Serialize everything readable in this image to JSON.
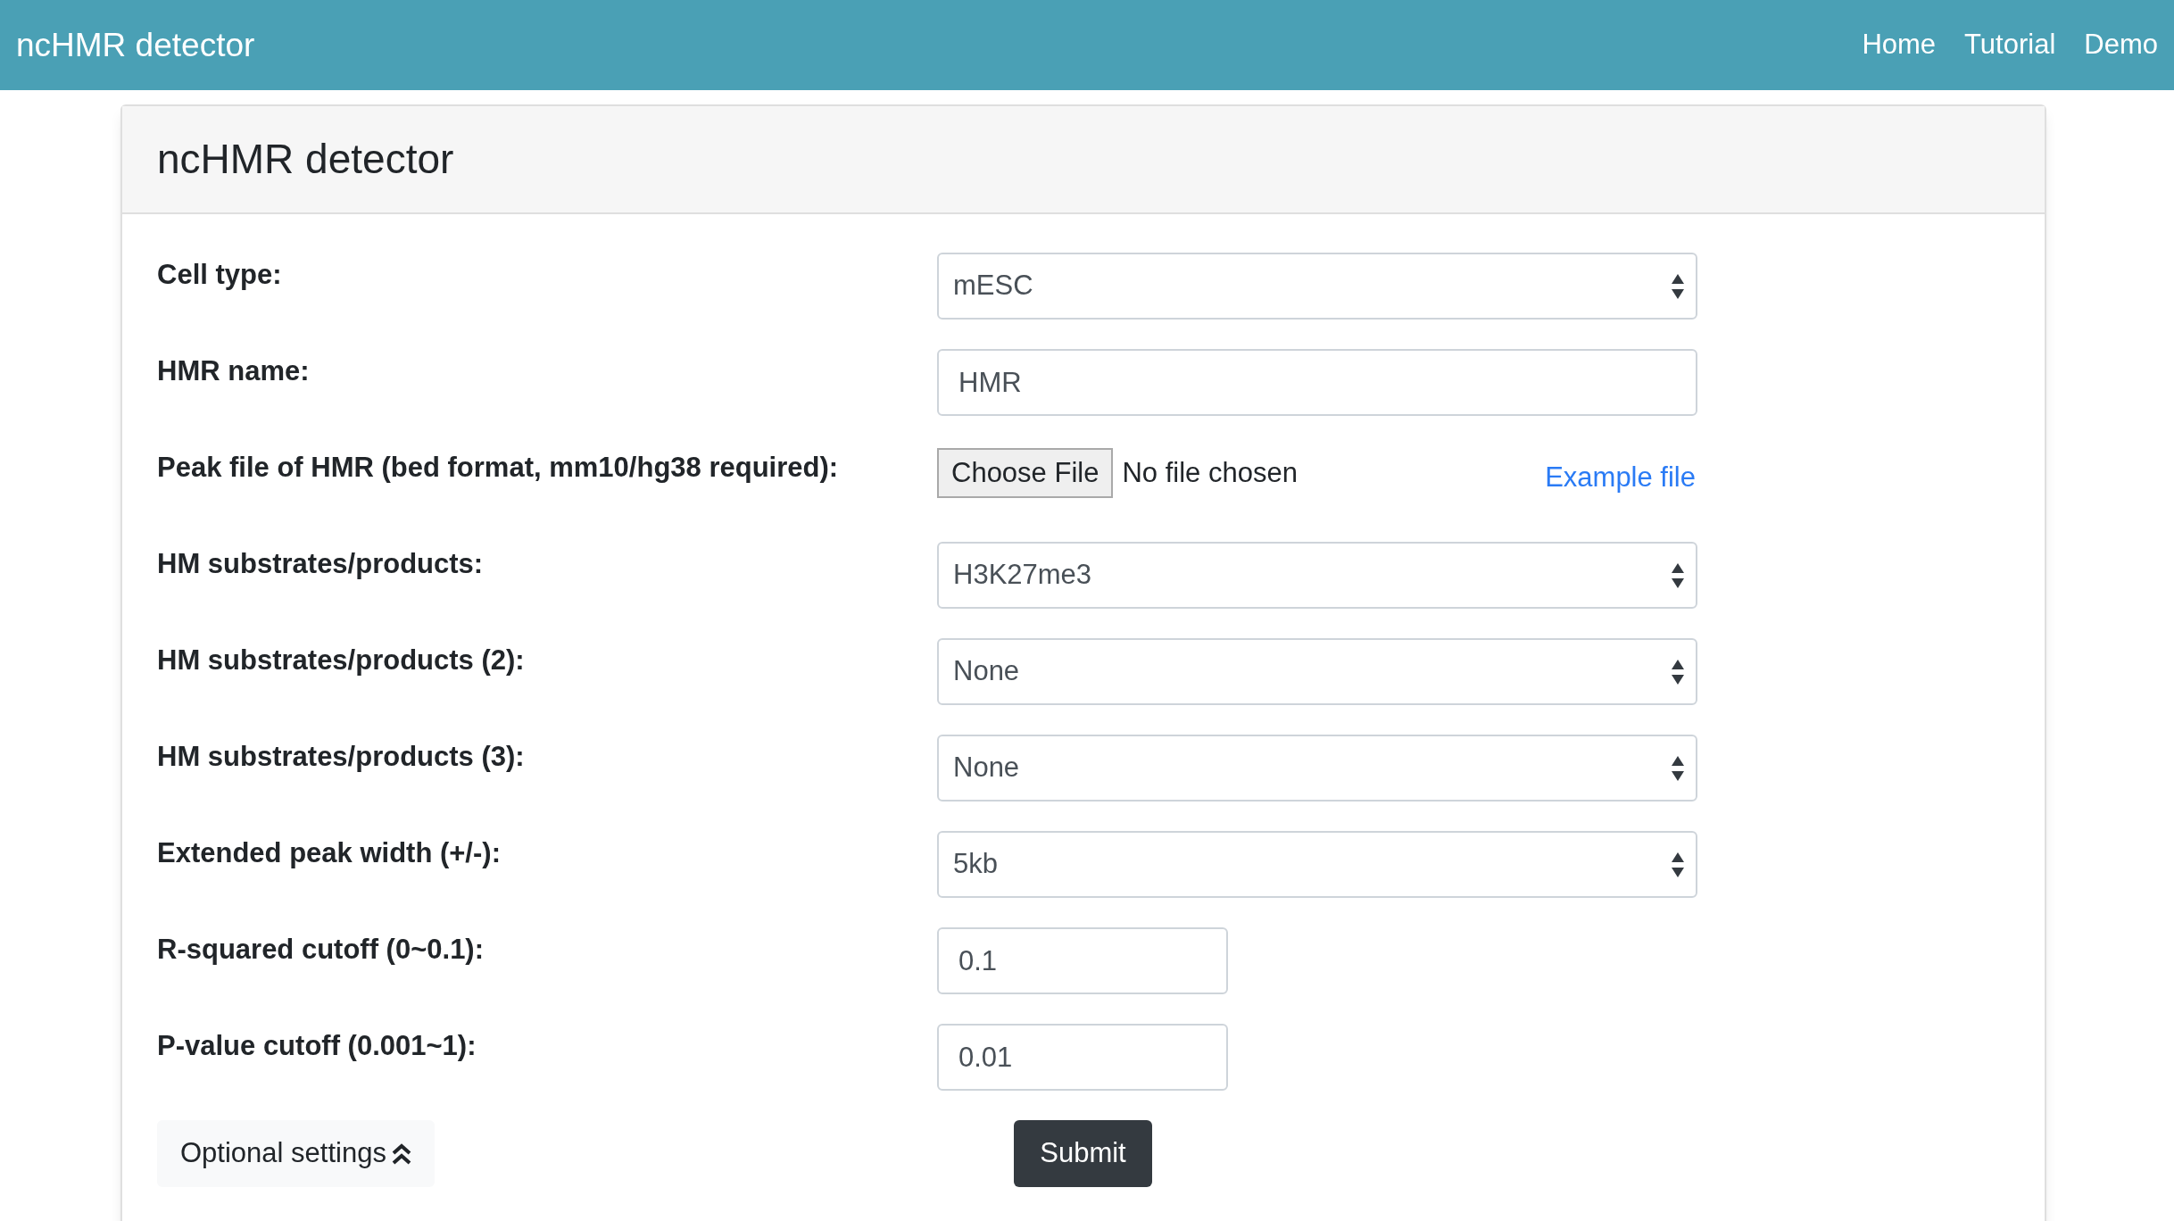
{
  "navbar": {
    "brand": "ncHMR detector",
    "links": [
      "Home",
      "Tutorial",
      "Demo"
    ]
  },
  "card": {
    "title": "ncHMR detector",
    "fields": [
      {
        "kind": "select",
        "label": "Cell type:",
        "value": "mESC"
      },
      {
        "kind": "text",
        "label": "HMR name:",
        "value": "HMR"
      },
      {
        "kind": "file",
        "label": "Peak file of HMR (bed format, mm10/hg38 required):",
        "button": "Choose File",
        "status": "No file chosen",
        "link": "Example file"
      },
      {
        "kind": "select",
        "label": "HM substrates/products:",
        "value": "H3K27me3"
      },
      {
        "kind": "select",
        "label": "HM substrates/products (2):",
        "value": "None"
      },
      {
        "kind": "select",
        "label": "HM substrates/products (3):",
        "value": "None"
      },
      {
        "kind": "select",
        "label": "Extended peak width (+/-):",
        "value": "5kb"
      },
      {
        "kind": "short",
        "label": "R-squared cutoff (0~0.1):",
        "value": "0.1"
      },
      {
        "kind": "short",
        "label": "P-value cutoff (0.001~1):",
        "value": "0.01"
      }
    ],
    "optional_button": "Optional settings",
    "submit_button": "Submit"
  }
}
